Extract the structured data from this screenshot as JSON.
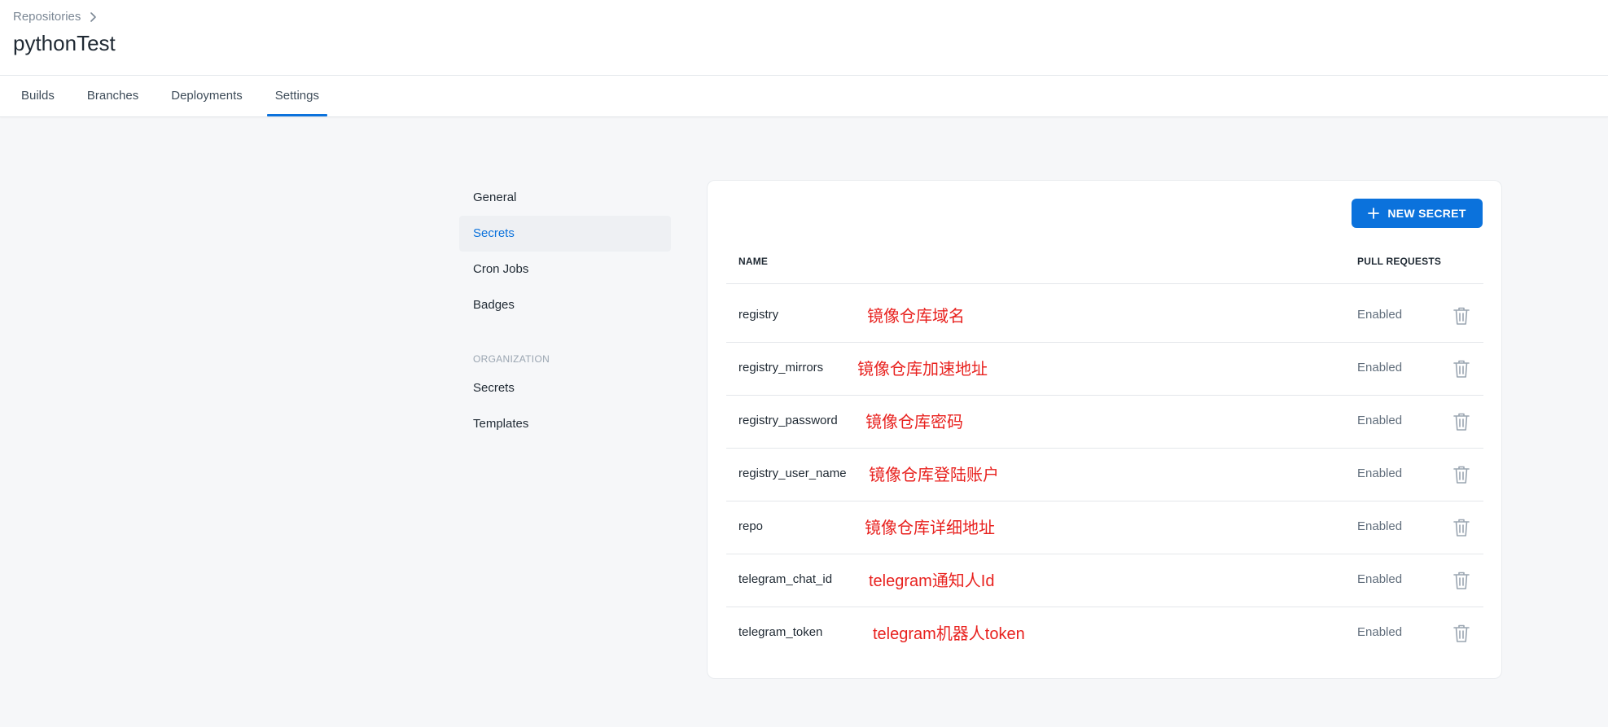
{
  "header": {
    "breadcrumb": "Repositories",
    "title": "pythonTest",
    "tabs": [
      {
        "label": "Builds"
      },
      {
        "label": "Branches"
      },
      {
        "label": "Deployments"
      },
      {
        "label": "Settings"
      }
    ]
  },
  "sidebar": {
    "items": [
      {
        "label": "General"
      },
      {
        "label": "Secrets"
      },
      {
        "label": "Cron Jobs"
      },
      {
        "label": "Badges"
      }
    ],
    "section": "ORGANIZATION",
    "org_items": [
      {
        "label": "Secrets"
      },
      {
        "label": "Templates"
      }
    ]
  },
  "secrets": {
    "new_button": "NEW SECRET",
    "columns": {
      "name": "NAME",
      "pull_requests": "PULL REQUESTS"
    },
    "rows": [
      {
        "name": "registry",
        "note": "镜像仓库域名",
        "pull_requests": "Enabled"
      },
      {
        "name": "registry_mirrors",
        "note": "镜像仓库加速地址",
        "pull_requests": "Enabled"
      },
      {
        "name": "registry_password",
        "note": "镜像仓库密码",
        "pull_requests": "Enabled"
      },
      {
        "name": "registry_user_name",
        "note": "镜像仓库登陆账户",
        "pull_requests": "Enabled"
      },
      {
        "name": "repo",
        "note": "镜像仓库详细地址",
        "pull_requests": "Enabled"
      },
      {
        "name": "telegram_chat_id",
        "note": "telegram通知人Id",
        "pull_requests": "Enabled"
      },
      {
        "name": "telegram_token",
        "note": "telegram机器人token",
        "pull_requests": "Enabled"
      }
    ]
  },
  "colors": {
    "accent": "#0b72dc",
    "annotation": "#e8221f"
  }
}
